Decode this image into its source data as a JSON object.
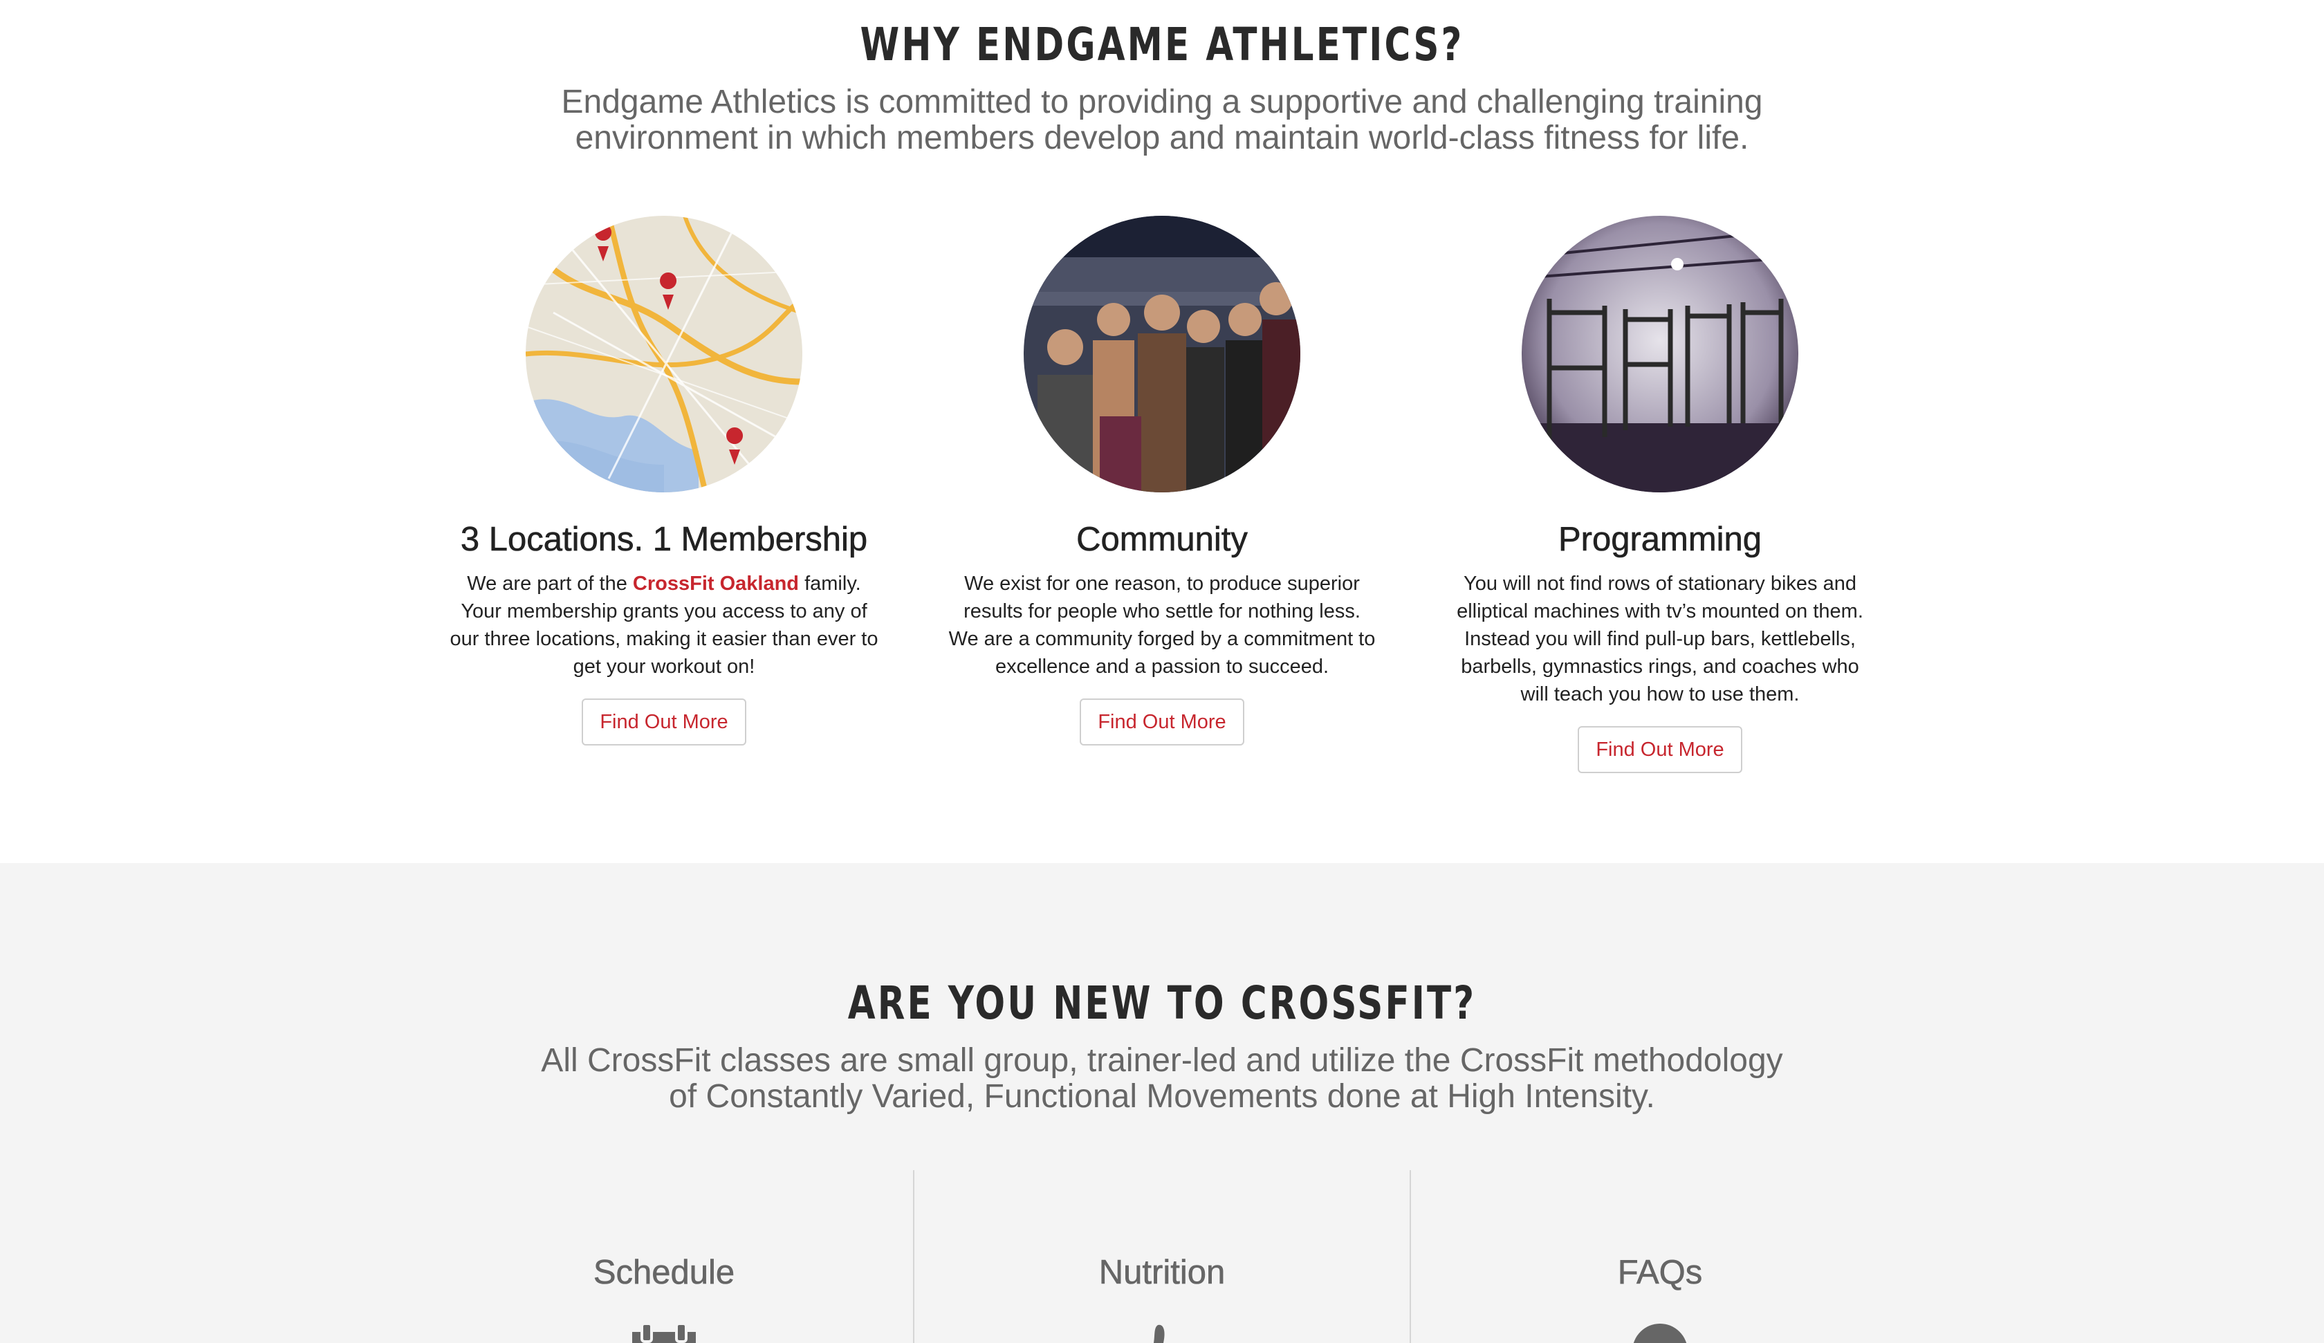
{
  "why": {
    "title": "WHY ENDGAME ATHLETICS?",
    "lead_line1": "Endgame Athletics is committed to providing a supportive and challenging training",
    "lead_line2": "environment in which members develop and maintain world-class fitness for life."
  },
  "features": [
    {
      "title": "3 Locations. 1 Membership",
      "text_before": "We are part of the ",
      "link": "CrossFit Oakland",
      "text_after": " family. Your membership grants you access to any of our three locations, making it easier than ever to get your workout on!",
      "button": "Find Out More",
      "image": "map-of-oakland-locations"
    },
    {
      "title": "Community",
      "text": "We exist for one reason, to produce superior results for people who settle for nothing less. We are a community forged by a commitment to excellence and a passion to succeed.",
      "button": "Find Out More",
      "image": "group-of-athletes-photo"
    },
    {
      "title": "Programming",
      "text": "You will not find rows of stationary bikes and elliptical machines with tv’s mounted on them. Instead you will find pull-up bars, kettlebells, barbells, gymnastics rings, and coaches who will teach you how to use them.",
      "button": "Find Out More",
      "image": "gym-rig-photo"
    }
  ],
  "new_to_crossfit": {
    "title": "ARE YOU NEW TO CROSSFIT?",
    "lead_line1": "All CrossFit classes are small group, trainer-led and utilize the CrossFit methodology",
    "lead_line2": "of Constantly Varied, Functional Movements done at High Intensity.",
    "cards": [
      {
        "title": "Schedule",
        "icon": "calendar-icon"
      },
      {
        "title": "Nutrition",
        "icon": "apple-icon"
      },
      {
        "title": "FAQs",
        "icon": "question-circle-icon"
      }
    ]
  },
  "colors": {
    "accent": "#c7262e",
    "heading": "#2a2a2a",
    "muted": "#666666",
    "band": "#f4f4f4"
  }
}
